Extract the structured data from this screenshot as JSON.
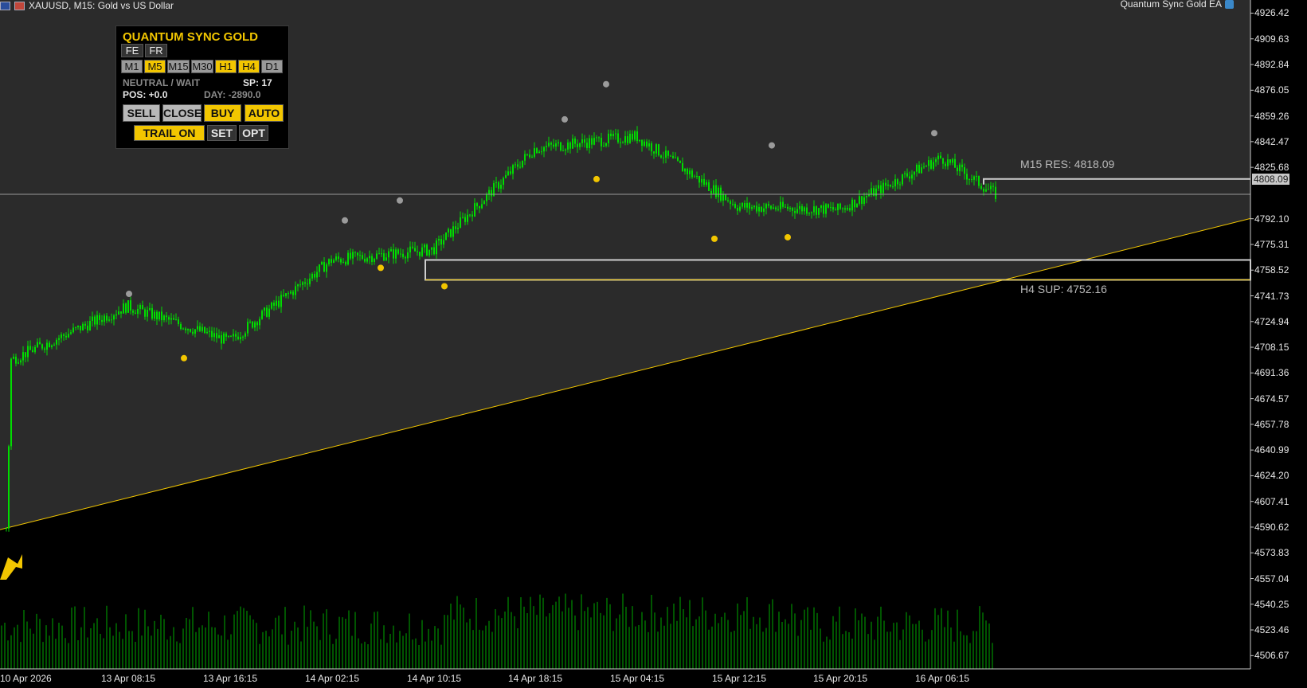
{
  "window": {
    "title": "XAUUSD, M15:  Gold vs US Dollar",
    "ea_name": "Quantum Sync Gold EA"
  },
  "price_axis": {
    "ticks": [
      "4926.42",
      "4909.63",
      "4892.84",
      "4876.05",
      "4859.26",
      "4842.47",
      "4825.68",
      "4792.10",
      "4775.31",
      "4758.52",
      "4741.73",
      "4724.94",
      "4708.15",
      "4691.36",
      "4674.57",
      "4657.78",
      "4640.99",
      "4624.20",
      "4607.41",
      "4590.62",
      "4573.83",
      "4557.04",
      "4540.25",
      "4523.46",
      "4506.67"
    ],
    "current_price": "4808.09"
  },
  "time_axis": {
    "labels": [
      "10 Apr 2026",
      "13 Apr 08:15",
      "13 Apr 16:15",
      "14 Apr 02:15",
      "14 Apr 10:15",
      "14 Apr 18:15",
      "15 Apr 04:15",
      "15 Apr 12:15",
      "15 Apr 20:15",
      "16 Apr 06:15"
    ]
  },
  "levels": {
    "resistance_label": "M15 RES: 4818.09",
    "support_label": "H4 SUP: 4752.16"
  },
  "panel": {
    "title": "QUANTUM SYNC GOLD",
    "fe": "FE",
    "fr": "FR",
    "timeframes": [
      {
        "label": "M1",
        "active": false
      },
      {
        "label": "M5",
        "active": true
      },
      {
        "label": "M15",
        "active": false
      },
      {
        "label": "M30",
        "active": false
      },
      {
        "label": "H1",
        "active": true
      },
      {
        "label": "H4",
        "active": true
      },
      {
        "label": "D1",
        "active": false
      }
    ],
    "status": "NEUTRAL / WAIT",
    "spread": "SP: 17",
    "position": "POS: +0.0",
    "day": "DAY: -2890.0",
    "sell": "SELL",
    "close": "CLOSE",
    "buy": "BUY",
    "auto": "AUTO",
    "trail": "TRAIL ON",
    "set": "SET",
    "opt": "OPT"
  },
  "colors": {
    "background_upper": "#2b2b2b",
    "background_lower": "#000000",
    "candle": "#00dd00",
    "volume": "#00aa00",
    "accent": "#f2c600",
    "level_line": "#cfcfcf"
  },
  "chart_data": {
    "type": "candlestick",
    "symbol": "XAUUSD",
    "timeframe": "M15",
    "ylim": [
      4498,
      4935
    ],
    "current_price": 4808.09,
    "key_closes": [
      {
        "time": "10 Apr 2026",
        "price": 4590
      },
      {
        "time": "10 Apr 2026",
        "price": 4700
      },
      {
        "time": "13 Apr 08:15",
        "price": 4735
      },
      {
        "time": "13 Apr 16:15",
        "price": 4712
      },
      {
        "time": "14 Apr 02:15",
        "price": 4765
      },
      {
        "time": "14 Apr 10:15",
        "price": 4772
      },
      {
        "time": "14 Apr 18:15",
        "price": 4838
      },
      {
        "time": "15 Apr 04:15",
        "price": 4846
      },
      {
        "time": "15 Apr 12:15",
        "price": 4800
      },
      {
        "time": "15 Apr 20:15",
        "price": 4798
      },
      {
        "time": "16 Apr 06:15",
        "price": 4832
      },
      {
        "time": "16 Apr 06:15",
        "price": 4808
      }
    ],
    "resistance": 4818.09,
    "support": 4752.16,
    "trendline": [
      {
        "time": "10 Apr 2026",
        "price": 4590
      },
      {
        "time": "16 Apr 06:15",
        "price": 4742
      }
    ]
  }
}
